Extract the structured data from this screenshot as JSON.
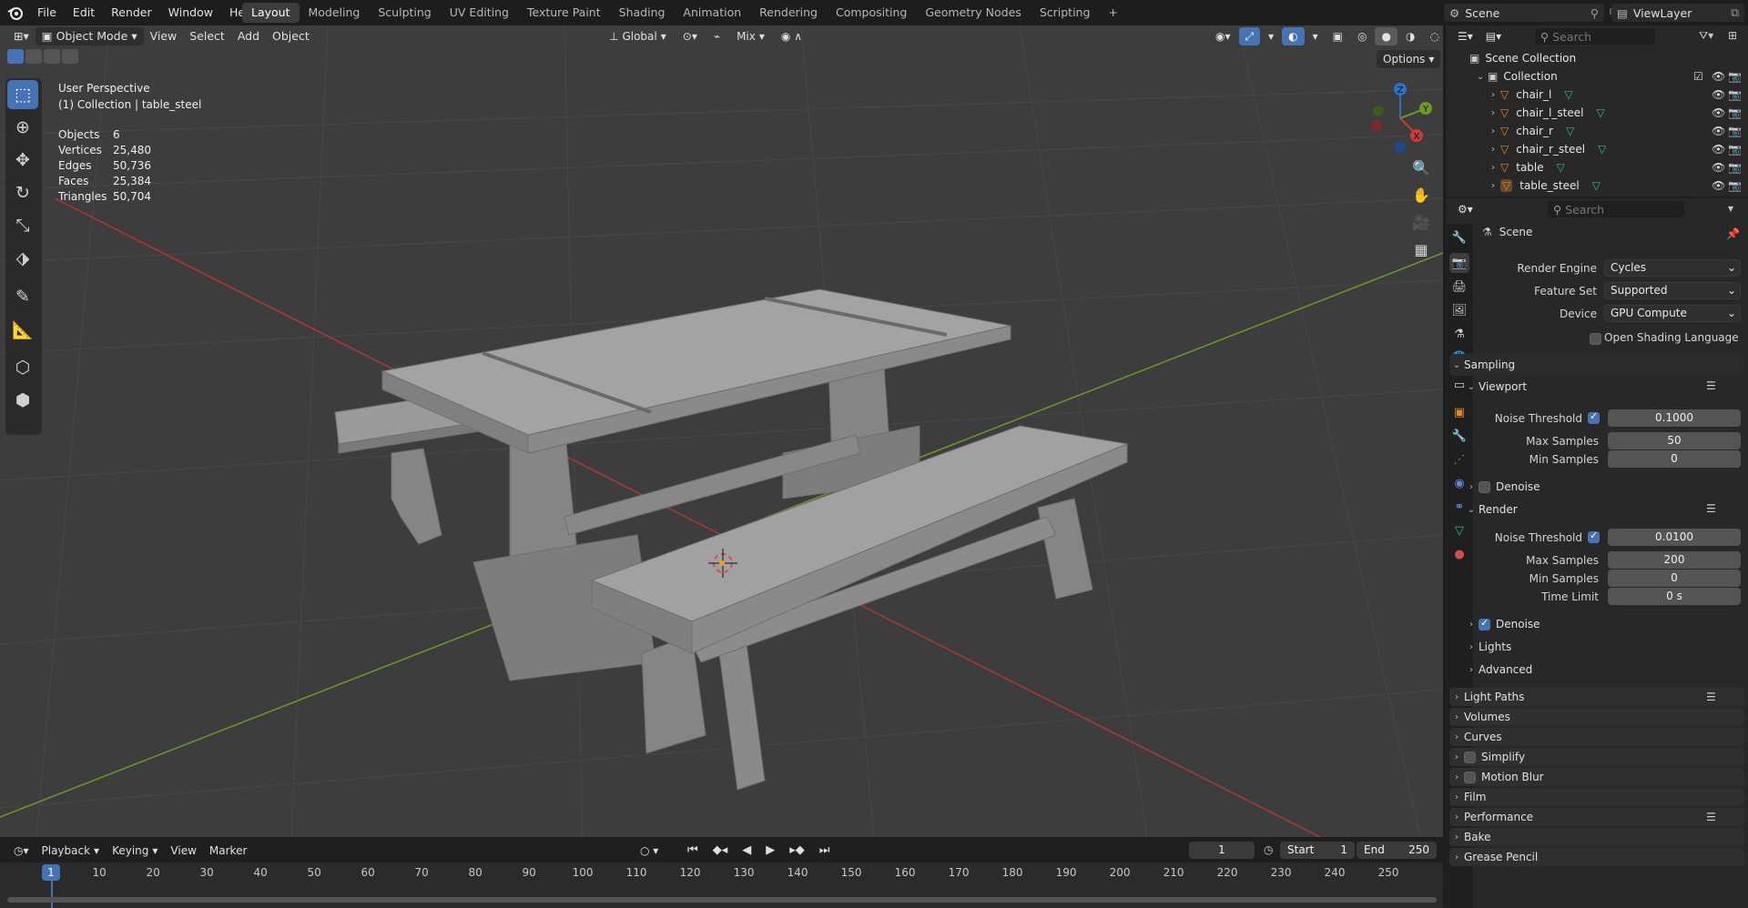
{
  "topbar": {
    "menus": [
      "File",
      "Edit",
      "Render",
      "Window",
      "Help"
    ],
    "workspaces": [
      "Layout",
      "Modeling",
      "Sculpting",
      "UV Editing",
      "Texture Paint",
      "Shading",
      "Animation",
      "Rendering",
      "Compositing",
      "Geometry Nodes",
      "Scripting"
    ],
    "active_workspace": "Layout",
    "add_tab": "+",
    "scene": "Scene",
    "view_layer": "ViewLayer"
  },
  "viewport": {
    "mode": "Object Mode",
    "menus": [
      "View",
      "Select",
      "Add",
      "Object"
    ],
    "transform_orientation": "Global",
    "snap_mode": "Mix",
    "options_label": "Options",
    "overlay_title": "User Perspective",
    "overlay_subtitle": "(1) Collection | table_steel",
    "stats": [
      {
        "k": "Objects",
        "v": "6"
      },
      {
        "k": "Vertices",
        "v": "25,480"
      },
      {
        "k": "Edges",
        "v": "50,736"
      },
      {
        "k": "Faces",
        "v": "25,384"
      },
      {
        "k": "Triangles",
        "v": "50,704"
      }
    ],
    "gizmo_labels": {
      "z": "Z",
      "y": "Y",
      "x": "X"
    }
  },
  "timeline": {
    "menus": [
      "Playback",
      "Keying",
      "View",
      "Marker"
    ],
    "current_frame": "1",
    "start_label": "Start",
    "start": "1",
    "end_label": "End",
    "end": "250",
    "ticks": [
      "1",
      "10",
      "20",
      "30",
      "40",
      "50",
      "60",
      "70",
      "80",
      "90",
      "100",
      "110",
      "120",
      "130",
      "140",
      "150",
      "160",
      "170",
      "180",
      "190",
      "200",
      "210",
      "220",
      "230",
      "240",
      "250"
    ]
  },
  "outliner": {
    "search_placeholder": "Search",
    "scene_collection": "Scene Collection",
    "collection": "Collection",
    "objects": [
      "chair_l",
      "chair_l_steel",
      "chair_r",
      "chair_r_steel",
      "table",
      "table_steel"
    ]
  },
  "properties": {
    "search_placeholder": "Search",
    "context": "Scene",
    "render_engine_label": "Render Engine",
    "render_engine": "Cycles",
    "feature_set_label": "Feature Set",
    "feature_set": "Supported",
    "device_label": "Device",
    "device": "GPU Compute",
    "osl_label": "Open Shading Language",
    "sampling": "Sampling",
    "viewport_panel": "Viewport",
    "noise_threshold_label": "Noise Threshold",
    "viewport_noise_threshold": "0.1000",
    "max_samples_label": "Max Samples",
    "viewport_max_samples": "50",
    "min_samples_label": "Min Samples",
    "viewport_min_samples": "0",
    "denoise_label": "Denoise",
    "render_panel": "Render",
    "render_noise_threshold": "0.0100",
    "render_max_samples": "200",
    "render_min_samples": "0",
    "time_limit_label": "Time Limit",
    "time_limit": "0 s",
    "lights": "Lights",
    "advanced": "Advanced",
    "sections": [
      "Light Paths",
      "Volumes",
      "Curves",
      "Simplify",
      "Motion Blur",
      "Film",
      "Performance",
      "Bake",
      "Grease Pencil"
    ]
  },
  "colors": {
    "accent": "#4772b3",
    "x_axis": "#c93b3b",
    "y_axis": "#6e9a27",
    "z_axis": "#2f6fc7"
  }
}
